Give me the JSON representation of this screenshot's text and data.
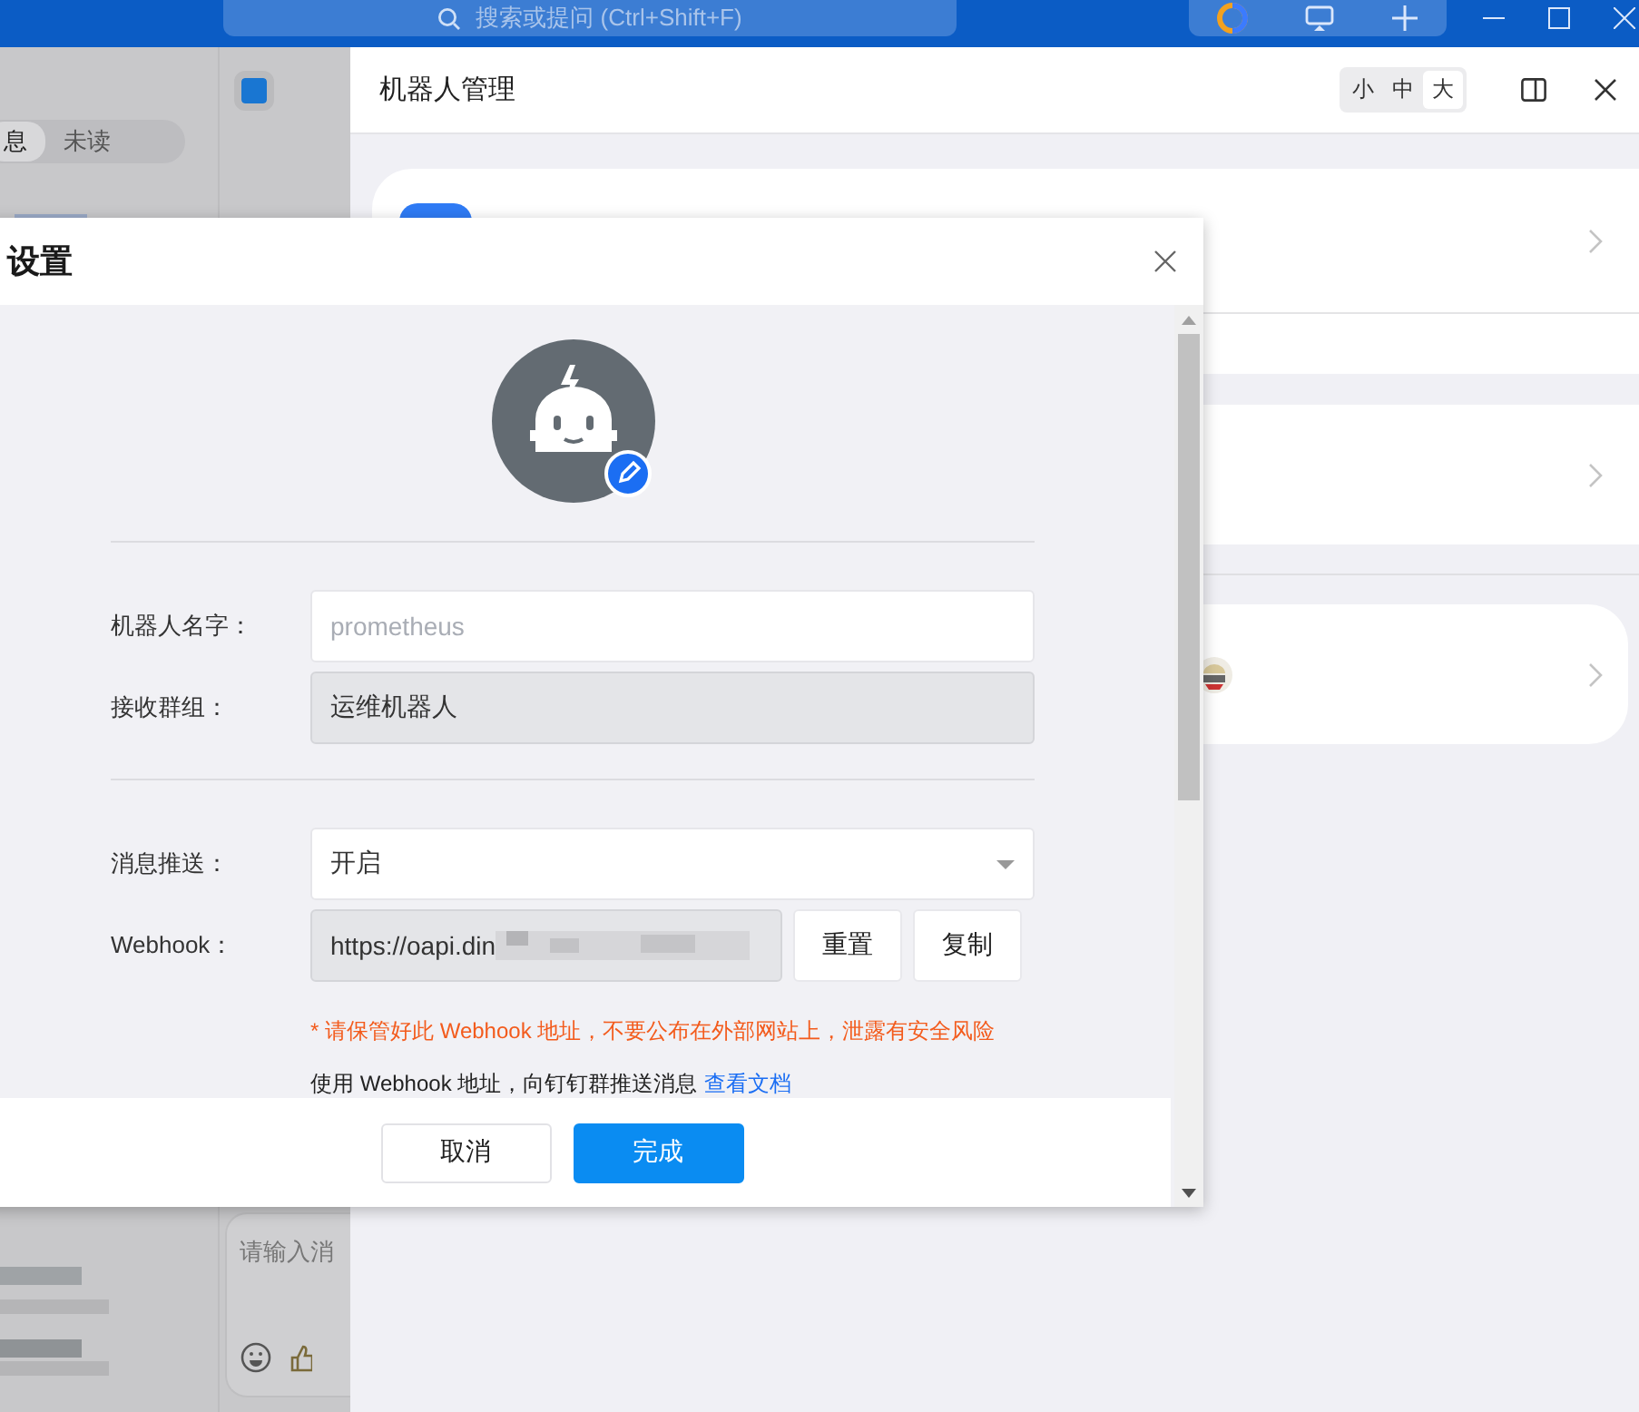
{
  "title_bar": {
    "search": {
      "placeholder": "搜索或提问 (Ctrl+Shift+F)"
    }
  },
  "chat_sidebar": {
    "tabs": [
      {
        "label": "息",
        "selected": true
      },
      {
        "label": "未读",
        "selected": false
      }
    ]
  },
  "chat_input": {
    "placeholder": "请输入消"
  },
  "robot_panel": {
    "title": "机器人管理",
    "sizes": [
      {
        "label": "小",
        "selected": false
      },
      {
        "label": "中",
        "selected": false
      },
      {
        "label": "大",
        "selected": true
      }
    ]
  },
  "dialog": {
    "title": "设置",
    "fields": [
      {
        "kind": "text",
        "label": "机器人名字：",
        "placeholder": "prometheus",
        "disabled": false
      },
      {
        "kind": "text",
        "label": "接收群组：",
        "value": "运维机器人",
        "disabled": true
      },
      {
        "kind": "select",
        "label": "消息推送：",
        "value": "开启",
        "disabled": false
      },
      {
        "kind": "webhook",
        "label": "Webhook：",
        "value": "https://oapi.din",
        "disabled": true,
        "buttons": [
          "重置",
          "复制"
        ]
      }
    ],
    "warning": "* 请保管好此 Webhook 地址，不要公布在外部网站上，泄露有安全风险",
    "help": "使用 Webhook 地址，向钉钉群推送消息",
    "help_link": "查看文档",
    "buttons": [
      {
        "label": "取消",
        "kind": "default"
      },
      {
        "label": "完成",
        "kind": "primary"
      }
    ]
  }
}
